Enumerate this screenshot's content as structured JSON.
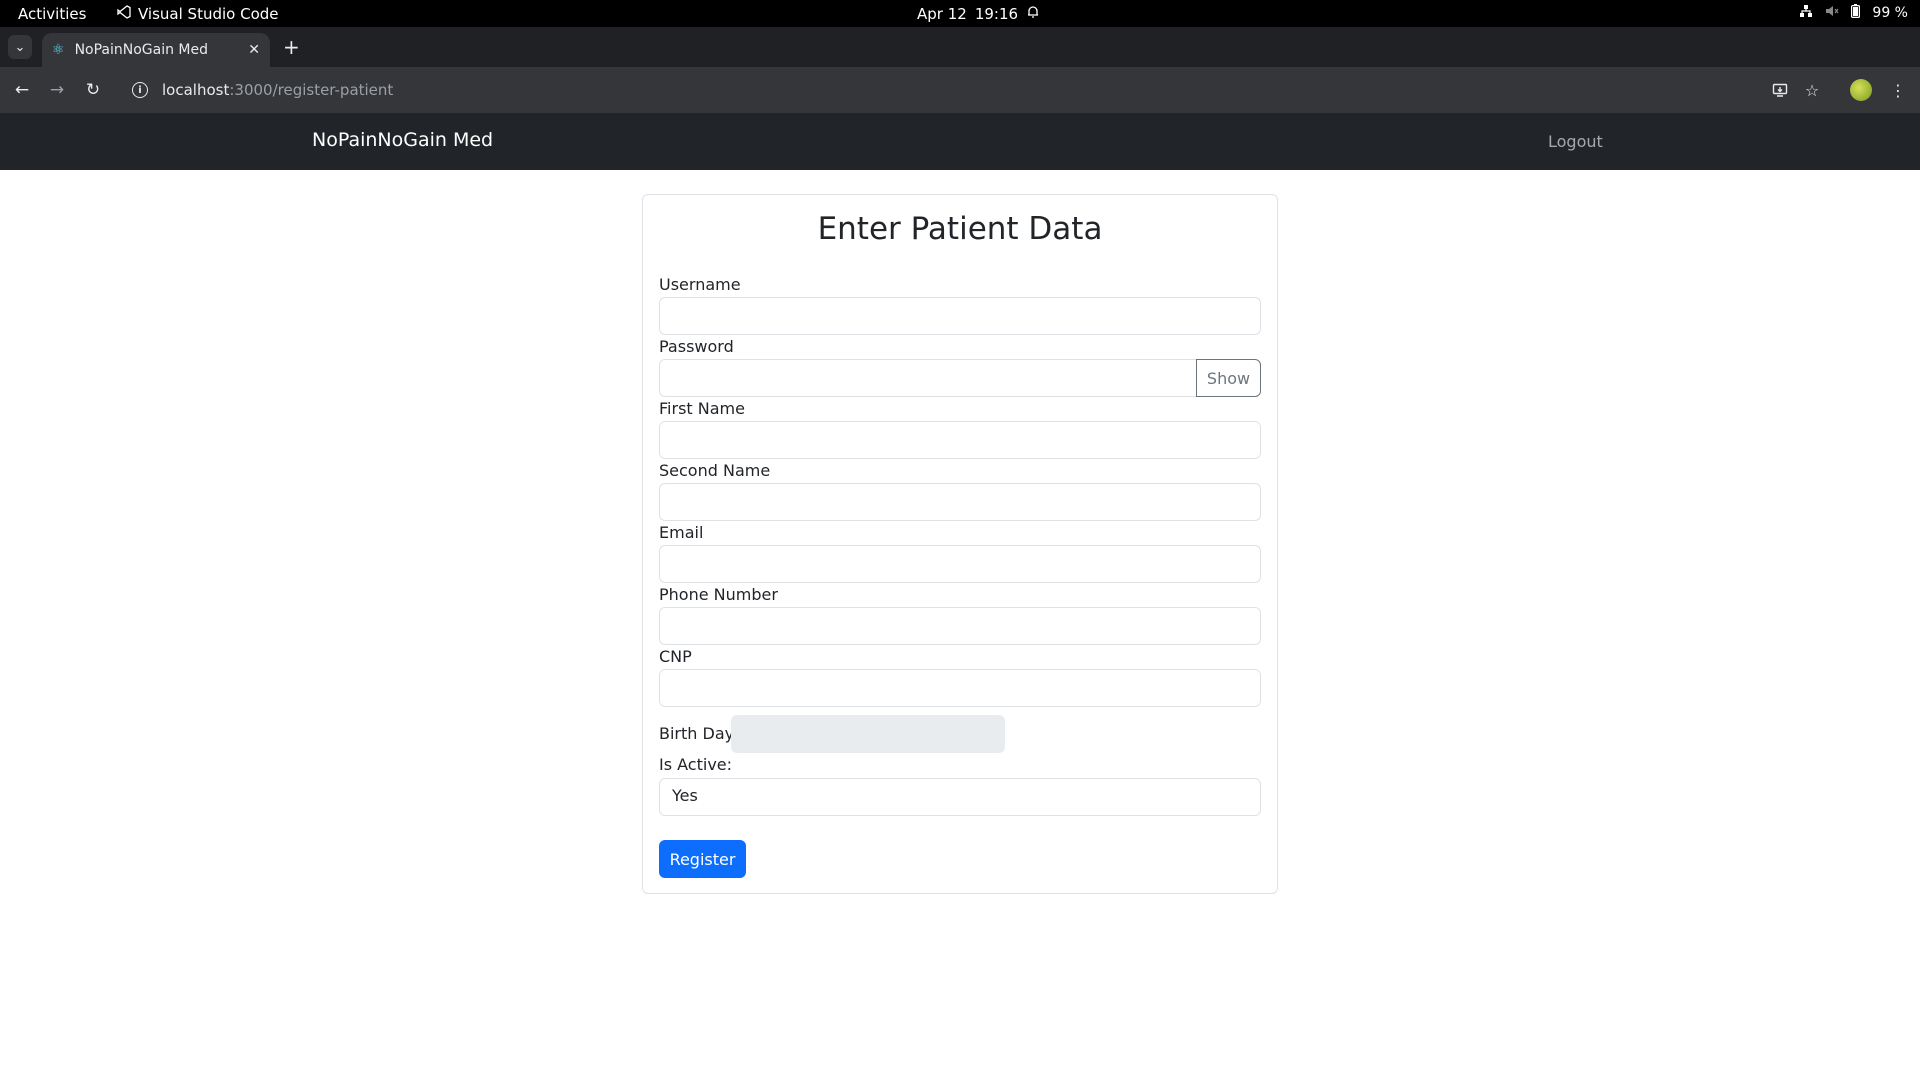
{
  "os_bar": {
    "activities": "Activities",
    "app_name": "Visual Studio Code",
    "date": "Apr 12",
    "time": "19:16",
    "battery": "99 %"
  },
  "browser": {
    "tab_title": "NoPainNoGain Med",
    "url_host": "localhost",
    "url_path": ":3000/register-patient"
  },
  "navbar": {
    "brand": "NoPainNoGain Med",
    "logout": "Logout"
  },
  "form": {
    "title": "Enter Patient Data",
    "username_label": "Username",
    "password_label": "Password",
    "show_button": "Show",
    "first_name_label": "First Name",
    "second_name_label": "Second Name",
    "email_label": "Email",
    "phone_label": "Phone Number",
    "cnp_label": "CNP",
    "birthday_label": "Birth Day:",
    "is_active_label": "Is Active:",
    "is_active_value": "Yes",
    "register_button": "Register"
  }
}
